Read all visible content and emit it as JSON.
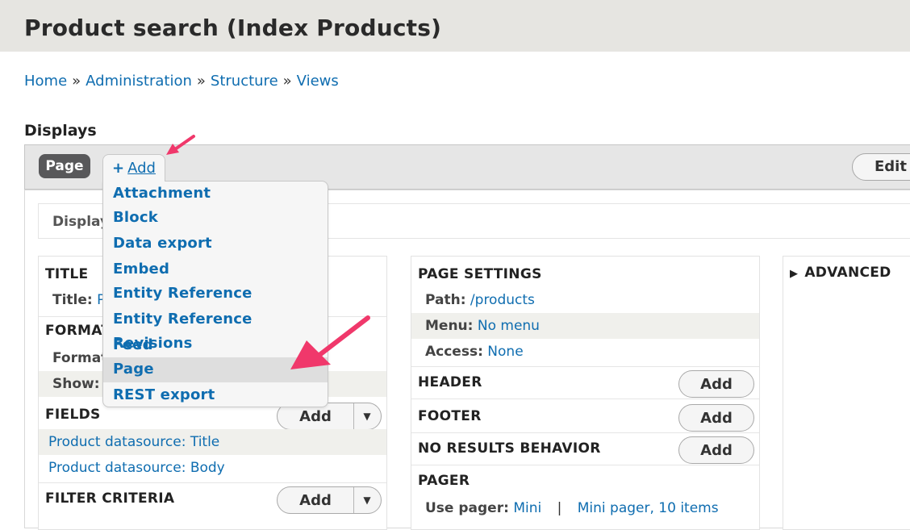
{
  "header": {
    "title": "Product search (Index Products)"
  },
  "breadcrumb": {
    "items": [
      "Home",
      "Administration",
      "Structure",
      "Views"
    ],
    "separator": "»"
  },
  "displays": {
    "label": "Displays",
    "active_tab": "Page",
    "add_icon": "+",
    "add_label": "Add",
    "edit_label": "Edit v",
    "dropdown": [
      "Attachment",
      "Block",
      "Data export",
      "Embed",
      "Entity Reference",
      "Entity Reference Revisions",
      "Feed",
      "Page",
      "REST export"
    ],
    "highlighted_item": "Page"
  },
  "display_name_label": "Display",
  "left": {
    "title_section": "TITLE",
    "title_key": "Title:",
    "title_value": "P",
    "format_section": "FORMAT",
    "format_key": "Format",
    "show_key": "Show:",
    "fields_section": "FIELDS",
    "fields_add": "Add",
    "fields": [
      "Product datasource: Title",
      "Product datasource: Body"
    ],
    "filter_section": "FILTER CRITERIA",
    "filter_add": "Add",
    "caret": "▼"
  },
  "middle": {
    "page_settings": "PAGE SETTINGS",
    "path_key": "Path:",
    "path_value": "/products",
    "menu_key": "Menu:",
    "menu_value": "No menu",
    "access_key": "Access:",
    "access_value": "None",
    "header_section": "HEADER",
    "footer_section": "FOOTER",
    "no_results_section": "NO RESULTS BEHAVIOR",
    "add_label": "Add",
    "pager_section": "PAGER",
    "use_pager_key": "Use pager:",
    "use_pager_value": "Mini",
    "pager_sep": "|",
    "pager_options": "Mini pager, 10 items"
  },
  "right": {
    "advanced_toggle": "▶",
    "advanced_label": "ADVANCED"
  },
  "colors": {
    "link": "#0f6db0",
    "annotation_arrow": "#f0386b",
    "header_bg": "#e6e5e1",
    "active_tab_bg": "#58585a"
  }
}
